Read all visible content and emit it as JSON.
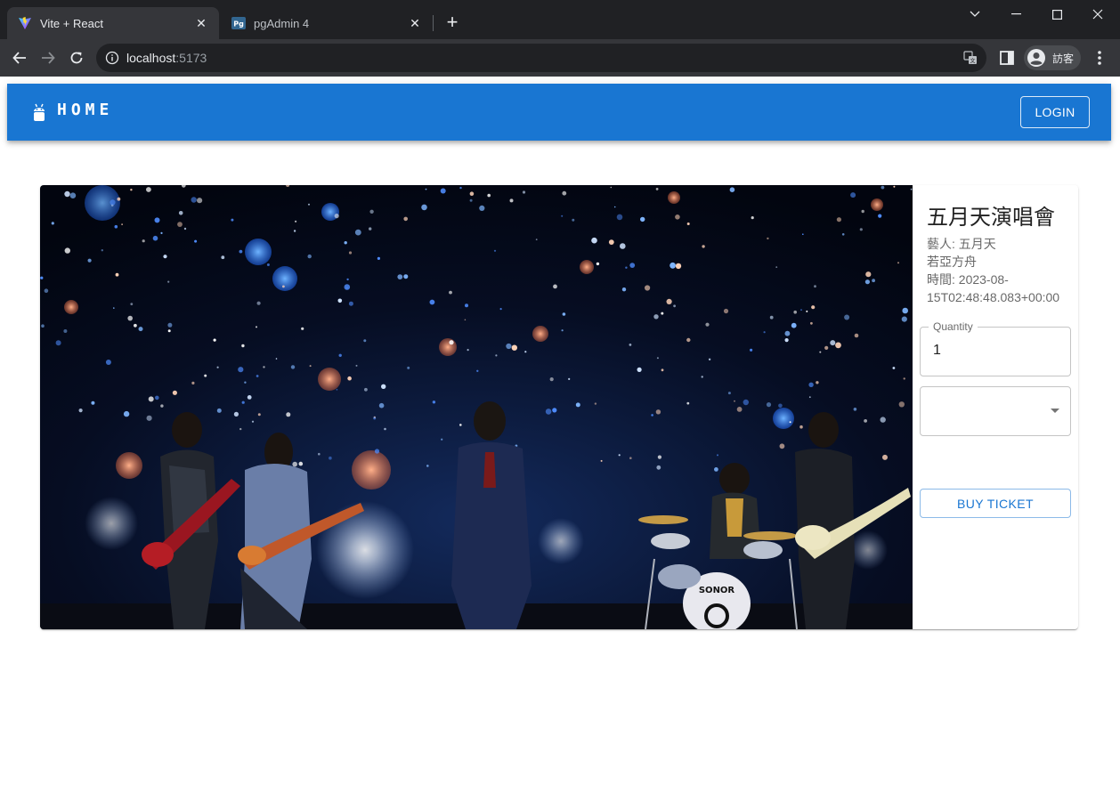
{
  "browser": {
    "tabs": [
      {
        "title": "Vite + React",
        "favicon": "vite-icon",
        "active": true
      },
      {
        "title": "pgAdmin 4",
        "favicon": "pgadmin-icon",
        "favicon_text": "Pg",
        "active": false
      }
    ],
    "url": {
      "host": "localhost",
      "port": ":5173"
    },
    "profile_label": "訪客"
  },
  "appbar": {
    "title": "HOME",
    "logo_icon": "android-icon",
    "login_label": "LOGIN",
    "color": "#1976d2"
  },
  "event": {
    "title": "五月天演唱會",
    "artist_line": "藝人: 五月天",
    "members_line": "若亞方舟",
    "time_line_1": "時間: 2023-08-",
    "time_line_2": "15T02:48:48.083+00:00",
    "image_alt": "concert-photo"
  },
  "form": {
    "quantity_label": "Quantity",
    "quantity_value": "1",
    "select_value": "",
    "buy_label": "BUY TICKET"
  }
}
